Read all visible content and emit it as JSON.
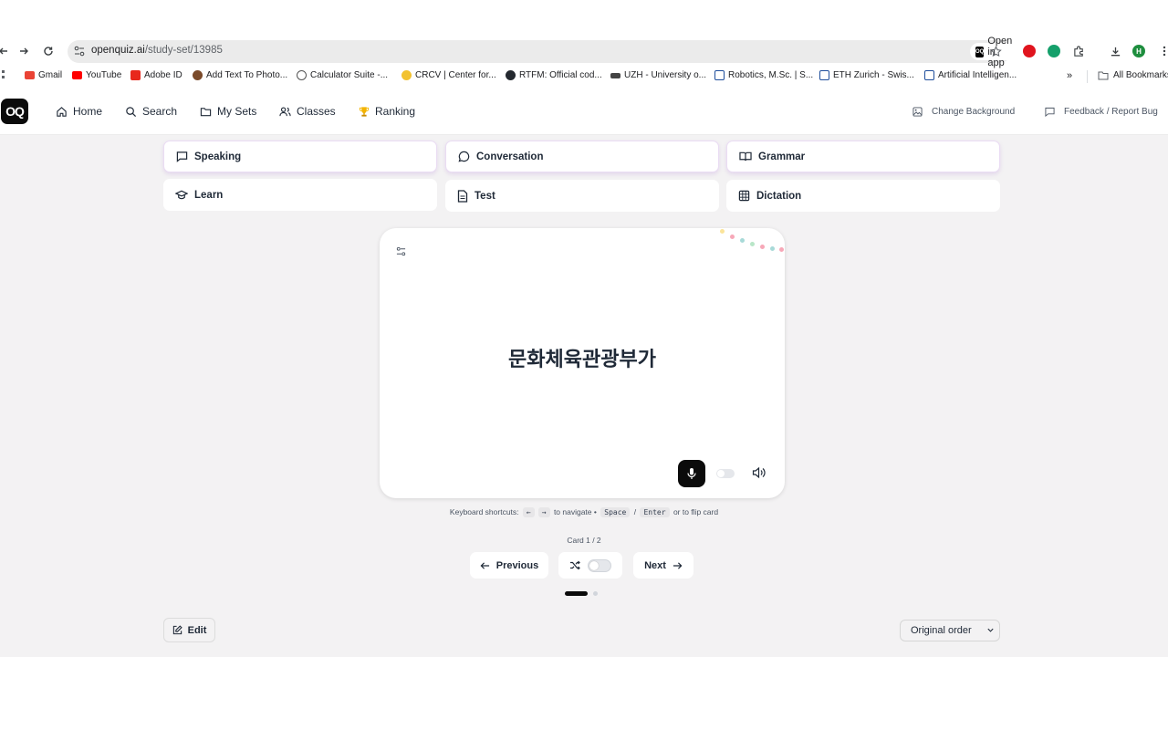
{
  "browser": {
    "url_host": "openquiz.ai",
    "url_path": "/study-set/13985",
    "open_in_app": "Open in app",
    "profile_initial": "H"
  },
  "bookmarks": {
    "items": [
      {
        "label": "Gmail",
        "icon": "gmail-icon",
        "color": "#ea4335"
      },
      {
        "label": "YouTube",
        "icon": "youtube-icon",
        "color": "#ff0000"
      },
      {
        "label": "Adobe ID",
        "icon": "adobe-icon",
        "color": "#e8281c"
      },
      {
        "label": "Add Text To Photo...",
        "icon": "photo-icon",
        "color": "#7a4a2a"
      },
      {
        "label": "Calculator Suite -...",
        "icon": "geogebra-icon",
        "color": "#555555"
      },
      {
        "label": "CRCV | Center for...",
        "icon": "crcv-icon",
        "color": "#f2c230"
      },
      {
        "label": "RTFM: Official cod...",
        "icon": "github-icon",
        "color": "#24292f"
      },
      {
        "label": "UZH - University o...",
        "icon": "uzh-icon",
        "color": "#444444"
      },
      {
        "label": "Robotics, M.Sc. | S...",
        "icon": "eth-icon",
        "color": "#1f4e9c"
      },
      {
        "label": "ETH Zurich - Swis...",
        "icon": "eth-icon",
        "color": "#1f4e9c"
      },
      {
        "label": "Artificial Intelligen...",
        "icon": "eth-icon",
        "color": "#1f4e9c"
      }
    ],
    "more": "»",
    "all_bookmarks": "All Bookmarks"
  },
  "nav": {
    "logo": "OQ",
    "home": "Home",
    "search": "Search",
    "my_sets": "My Sets",
    "classes": "Classes",
    "ranking": "Ranking",
    "change_background": "Change Background",
    "feedback": "Feedback / Report Bug"
  },
  "modes": {
    "speaking": "Speaking",
    "conversation": "Conversation",
    "grammar": "Grammar",
    "learn": "Learn",
    "test": "Test",
    "dictation": "Dictation"
  },
  "card": {
    "term": "문화체육관광부가"
  },
  "shortcuts": {
    "prefix": "Keyboard shortcuts:",
    "left": "←",
    "right": "→",
    "navigate": "to navigate •",
    "space": "Space",
    "slash": "/",
    "enter": "Enter",
    "flip": "or to flip card"
  },
  "counter": "Card 1 / 2",
  "controls": {
    "previous": "Previous",
    "next": "Next"
  },
  "progress": {
    "current": 1,
    "total": 2
  },
  "footer": {
    "edit": "Edit",
    "order": "Original order"
  },
  "colors": {
    "accent": "#0b0b0b",
    "page_bg": "#f3f2f3",
    "highlight_border": "#eadcf3"
  }
}
